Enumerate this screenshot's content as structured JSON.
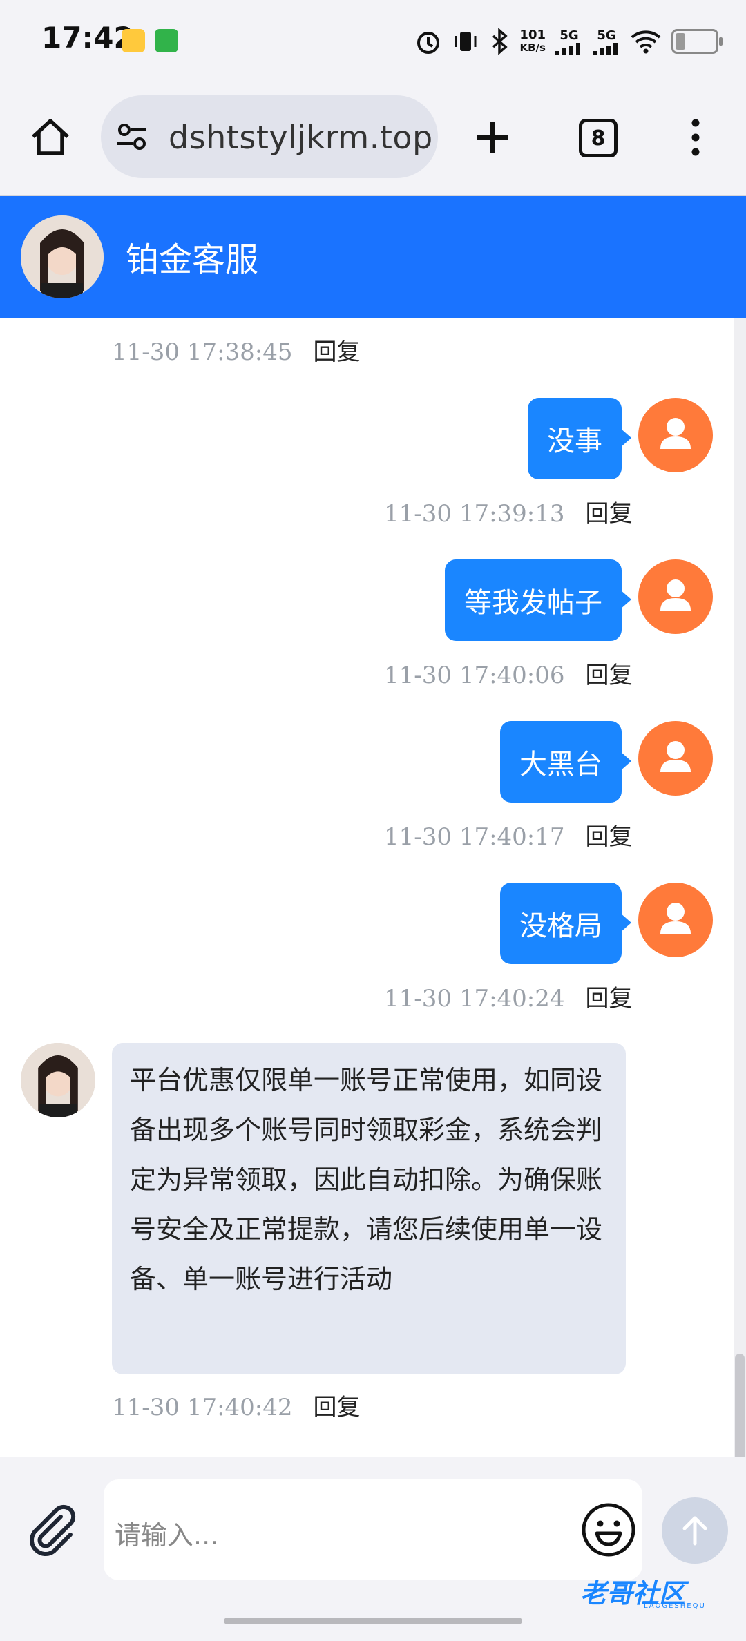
{
  "status_bar": {
    "time": "17:42",
    "net_speed_value": "101",
    "net_speed_unit": "KB/s",
    "signal1": "5G",
    "signal2": "5G",
    "icons": [
      "notes-icon",
      "task-icon",
      "alarm-icon",
      "vibrate-icon",
      "bluetooth-icon",
      "wifi-icon",
      "battery-icon"
    ]
  },
  "browser": {
    "url": "dshtstyljkrm.top",
    "tab_count": "8"
  },
  "chat": {
    "title": "铂金客服",
    "messages": [
      {
        "from": "agent",
        "time": "11-30 17:38:45",
        "reply": "回复"
      },
      {
        "from": "me",
        "text": "没事",
        "time": "11-30 17:39:13",
        "reply": "回复"
      },
      {
        "from": "me",
        "text": "等我发帖子",
        "time": "11-30 17:40:06",
        "reply": "回复"
      },
      {
        "from": "me",
        "text": "大黑台",
        "time": "11-30 17:40:17",
        "reply": "回复"
      },
      {
        "from": "me",
        "text": "没格局",
        "time": "11-30 17:40:24",
        "reply": "回复"
      },
      {
        "from": "agent",
        "text": "平台优惠仅限单一账号正常使用，如同设备出现多个账号同时领取彩金，系统会判定为异常领取，因此自动扣除。为确保账号安全及正常提款，请您后续使用单一设备、单一账号进行活动",
        "time": "11-30 17:40:42",
        "reply": "回复"
      }
    ]
  },
  "input": {
    "placeholder": "请输入..."
  },
  "watermark": {
    "text": "老哥社区",
    "sub": "LAOGESHEQU"
  },
  "colors": {
    "header": "#1a73ff",
    "my_bubble": "#1a86ff",
    "my_avatar": "#ff7a3a",
    "agent_bubble": "#e4e8f2"
  }
}
